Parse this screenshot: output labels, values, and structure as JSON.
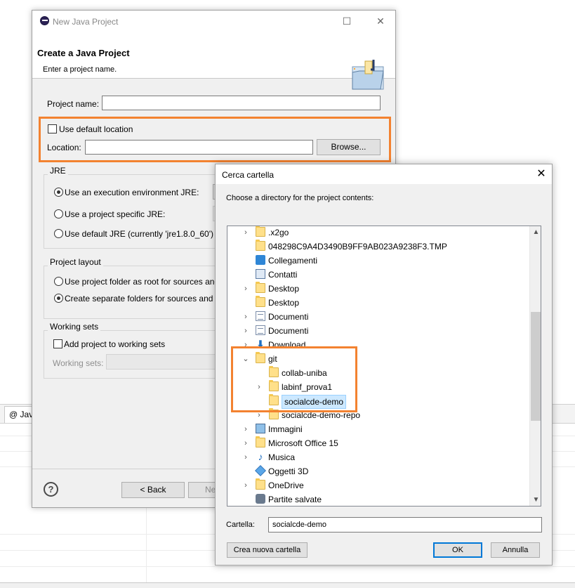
{
  "background": {
    "tab_label": "@ Jav"
  },
  "java_dialog": {
    "window_title": "New Java Project",
    "heading": "Create a Java Project",
    "subheading": "Enter a project name.",
    "project_name_label": "Project name:",
    "project_name_value": "",
    "use_default_location_label": "Use default location",
    "use_default_location_checked": false,
    "location_label": "Location:",
    "location_value": "",
    "browse_label": "Browse...",
    "jre_group": {
      "title": "JRE",
      "options": [
        {
          "label": "Use an execution environment JRE:",
          "selected": true
        },
        {
          "label": "Use a project specific JRE:",
          "selected": false
        },
        {
          "label": "Use default JRE (currently 'jre1.8.0_60')",
          "selected": false
        }
      ]
    },
    "layout_group": {
      "title": "Project layout",
      "options": [
        {
          "label": "Use project folder as root for sources and",
          "selected": false
        },
        {
          "label": "Create separate folders for sources and c",
          "selected": true
        }
      ]
    },
    "working_sets_group": {
      "title": "Working sets",
      "add_label": "Add project to working sets",
      "add_checked": false,
      "sets_label": "Working sets:"
    },
    "back_label": "< Back",
    "next_label": "Ne",
    "help_icon": "help-icon"
  },
  "browse_dialog": {
    "title": "Cerca cartella",
    "close_icon": "close-icon",
    "instruction": "Choose a directory for the project contents:",
    "tree": [
      {
        "label": ".x2go",
        "expander": ">",
        "icon": "folder",
        "level": 0
      },
      {
        "label": "048298C9A4D3490B9FF9AB023A9238F3.TMP",
        "expander": "",
        "icon": "folder",
        "level": 0
      },
      {
        "label": "Collegamenti",
        "expander": "",
        "icon": "links",
        "level": 0
      },
      {
        "label": "Contatti",
        "expander": "",
        "icon": "contacts",
        "level": 0
      },
      {
        "label": "Desktop",
        "expander": ">",
        "icon": "desktop",
        "level": 0
      },
      {
        "label": "Desktop",
        "expander": "",
        "icon": "folder",
        "level": 0
      },
      {
        "label": "Documenti",
        "expander": ">",
        "icon": "document",
        "level": 0
      },
      {
        "label": "Documenti",
        "expander": ">",
        "icon": "document",
        "level": 0
      },
      {
        "label": "Download",
        "expander": ">",
        "icon": "download",
        "level": 0
      },
      {
        "label": "git",
        "expander": "v",
        "icon": "folder",
        "level": 0
      },
      {
        "label": "collab-uniba",
        "expander": "",
        "icon": "folder",
        "level": 1
      },
      {
        "label": "labinf_prova1",
        "expander": ">",
        "icon": "folder",
        "level": 1
      },
      {
        "label": "socialcde-demo",
        "expander": "",
        "icon": "folder",
        "level": 1,
        "selected": true
      },
      {
        "label": "socialcde-demo-repo",
        "expander": ">",
        "icon": "folder",
        "level": 1
      },
      {
        "label": "Immagini",
        "expander": ">",
        "icon": "pictures",
        "level": 0
      },
      {
        "label": "Microsoft Office 15",
        "expander": ">",
        "icon": "folder",
        "level": 0
      },
      {
        "label": "Musica",
        "expander": ">",
        "icon": "music",
        "level": 0
      },
      {
        "label": "Oggetti 3D",
        "expander": "",
        "icon": "3d-objects",
        "level": 0
      },
      {
        "label": "OneDrive",
        "expander": ">",
        "icon": "folder",
        "level": 0
      },
      {
        "label": "Partite salvate",
        "expander": "",
        "icon": "saved-games",
        "level": 0
      }
    ],
    "folder_label": "Cartella:",
    "folder_value": "socialcde-demo",
    "new_folder_label": "Crea nuova cartella",
    "ok_label": "OK",
    "cancel_label": "Annulla"
  },
  "highlight_color": "#f38230"
}
